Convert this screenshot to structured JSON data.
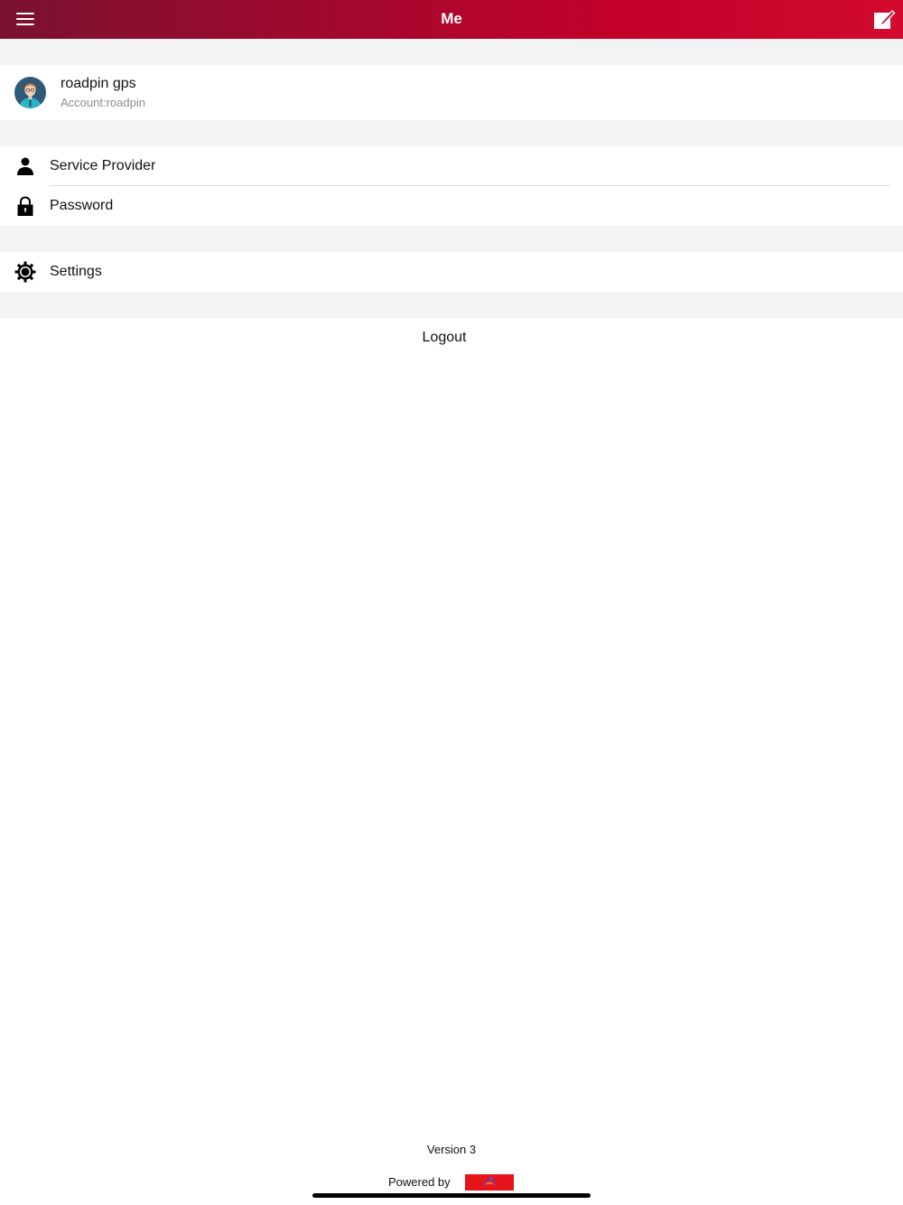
{
  "header": {
    "title": "Me",
    "background_colors": [
      "#7a1230",
      "#d20a2e"
    ]
  },
  "icons": {
    "menu": "hamburger-menu-icon",
    "edit": "edit-note-icon",
    "avatar": "user-avatar",
    "service_provider": "person-icon",
    "password": "lock-icon",
    "settings": "gear-icon"
  },
  "profile": {
    "name": "roadpin gps",
    "account": "Account:roadpin"
  },
  "menu_items": [
    {
      "label": "Service Provider"
    },
    {
      "label": "Password"
    },
    {
      "label": "Settings"
    }
  ],
  "logout_label": "Logout",
  "footer": {
    "version": "Version 3",
    "powered_by": "Powered by"
  },
  "colors": {
    "accent": "#c4002a",
    "section_gap": "#f3f3f3"
  }
}
